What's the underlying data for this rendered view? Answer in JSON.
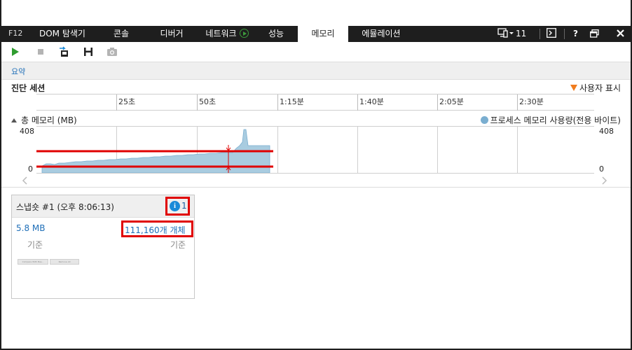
{
  "tabs": {
    "f12": "F12",
    "items": [
      {
        "label": "DOM 탐색기"
      },
      {
        "label": "콘솔"
      },
      {
        "label": "디버거"
      },
      {
        "label": "네트워크"
      },
      {
        "label": "성능"
      },
      {
        "label": "메모리",
        "active": true
      },
      {
        "label": "에뮬레이션"
      }
    ],
    "emulation_count": "11"
  },
  "toolbar": {
    "buttons": [
      "play-icon",
      "stop-icon",
      "import-icon",
      "save-icon",
      "camera-icon"
    ]
  },
  "summary": {
    "label": "요약"
  },
  "session": {
    "title": "진단 세션",
    "user_marks": "사용자 표시"
  },
  "ruler": {
    "labels": [
      "25초",
      "50초",
      "1:15분",
      "1:40분",
      "2:05분",
      "2:30분"
    ]
  },
  "memory": {
    "title": "총 메모리 (MB)",
    "legend": "프로세스 메모리 사용량(전용 바이트)",
    "y_max": "408",
    "y_min": "0",
    "series_color": "#7aaed0",
    "highlight_color": "#e00000"
  },
  "snapshot": {
    "title": "스냅숏 #1 (오후 8:06:13)",
    "info_count": "1",
    "heap_size": "5.8 MB",
    "objects": "111,160개 개체",
    "base_left": "기준",
    "base_right": "기준",
    "mini_buttons": [
      "Compare With Bas…",
      "Remove All"
    ]
  }
}
